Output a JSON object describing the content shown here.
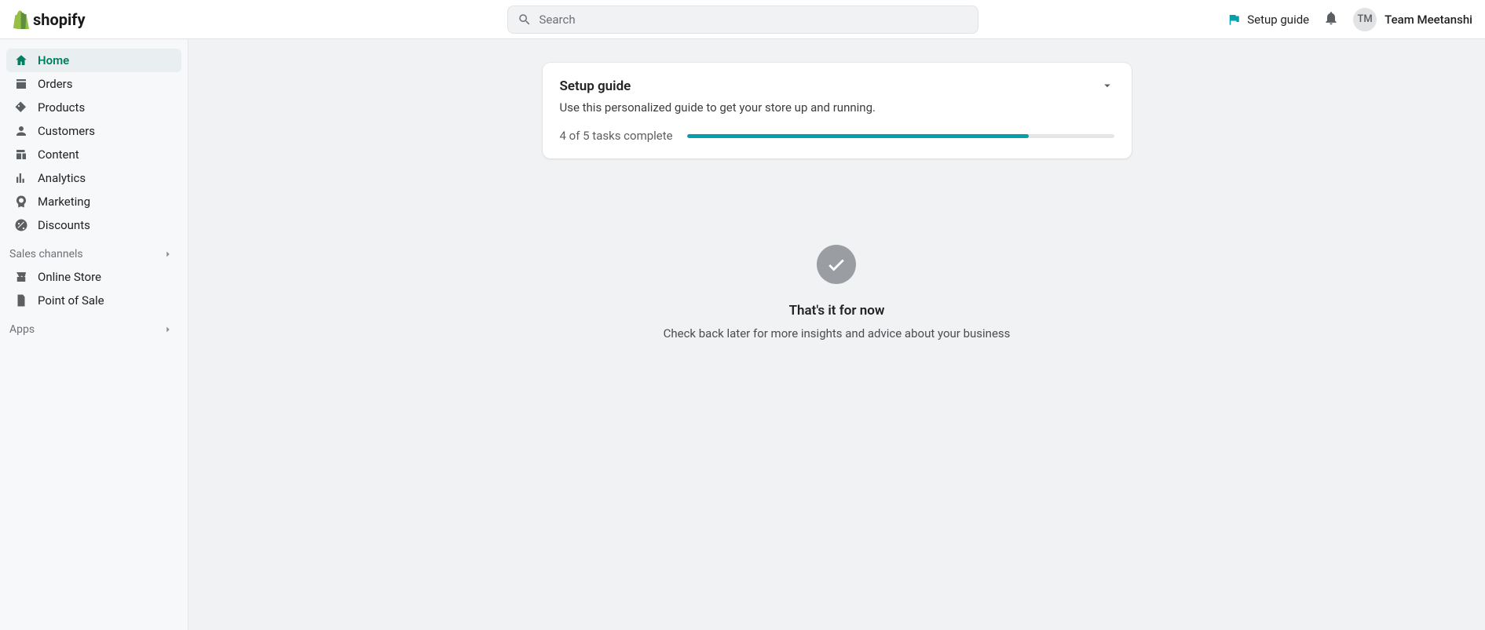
{
  "header": {
    "brand": "shopify",
    "search_placeholder": "Search",
    "setup_guide_label": "Setup guide",
    "avatar_initials": "TM",
    "user_name": "Team Meetanshi"
  },
  "sidebar": {
    "primary": [
      {
        "label": "Home",
        "icon": "home",
        "active": true
      },
      {
        "label": "Orders",
        "icon": "orders",
        "active": false
      },
      {
        "label": "Products",
        "icon": "products",
        "active": false
      },
      {
        "label": "Customers",
        "icon": "customers",
        "active": false
      },
      {
        "label": "Content",
        "icon": "content",
        "active": false
      },
      {
        "label": "Analytics",
        "icon": "analytics",
        "active": false
      },
      {
        "label": "Marketing",
        "icon": "marketing",
        "active": false
      },
      {
        "label": "Discounts",
        "icon": "discounts",
        "active": false
      }
    ],
    "sales_channels_header": "Sales channels",
    "sales_channels": [
      {
        "label": "Online Store",
        "icon": "store"
      },
      {
        "label": "Point of Sale",
        "icon": "pos"
      }
    ],
    "apps_header": "Apps"
  },
  "setup_card": {
    "title": "Setup guide",
    "subtitle": "Use this personalized guide to get your store up and running.",
    "progress_label": "4 of 5 tasks complete",
    "progress_percent": 80
  },
  "empty": {
    "title": "That's it for now",
    "subtitle": "Check back later for more insights and advice about your business"
  }
}
